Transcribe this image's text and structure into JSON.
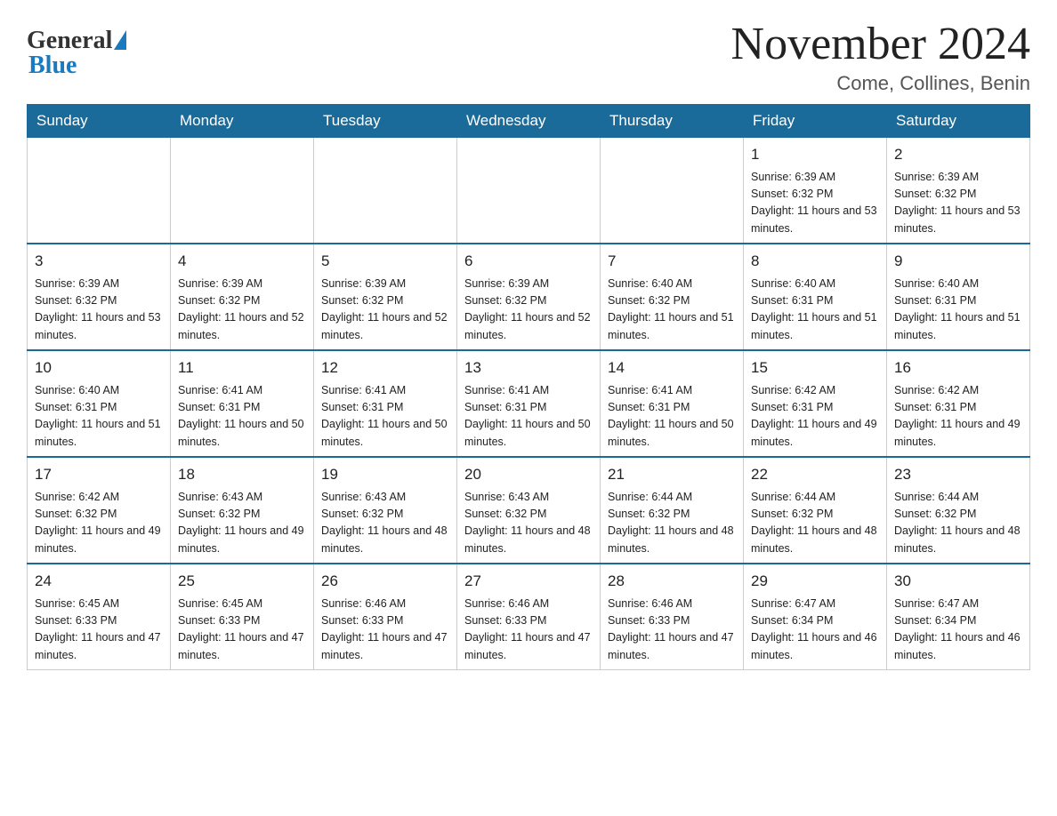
{
  "header": {
    "logo_general": "General",
    "logo_blue": "Blue",
    "month_title": "November 2024",
    "location": "Come, Collines, Benin"
  },
  "days_of_week": [
    "Sunday",
    "Monday",
    "Tuesday",
    "Wednesday",
    "Thursday",
    "Friday",
    "Saturday"
  ],
  "weeks": [
    [
      {
        "day": "",
        "info": ""
      },
      {
        "day": "",
        "info": ""
      },
      {
        "day": "",
        "info": ""
      },
      {
        "day": "",
        "info": ""
      },
      {
        "day": "",
        "info": ""
      },
      {
        "day": "1",
        "info": "Sunrise: 6:39 AM\nSunset: 6:32 PM\nDaylight: 11 hours and 53 minutes."
      },
      {
        "day": "2",
        "info": "Sunrise: 6:39 AM\nSunset: 6:32 PM\nDaylight: 11 hours and 53 minutes."
      }
    ],
    [
      {
        "day": "3",
        "info": "Sunrise: 6:39 AM\nSunset: 6:32 PM\nDaylight: 11 hours and 53 minutes."
      },
      {
        "day": "4",
        "info": "Sunrise: 6:39 AM\nSunset: 6:32 PM\nDaylight: 11 hours and 52 minutes."
      },
      {
        "day": "5",
        "info": "Sunrise: 6:39 AM\nSunset: 6:32 PM\nDaylight: 11 hours and 52 minutes."
      },
      {
        "day": "6",
        "info": "Sunrise: 6:39 AM\nSunset: 6:32 PM\nDaylight: 11 hours and 52 minutes."
      },
      {
        "day": "7",
        "info": "Sunrise: 6:40 AM\nSunset: 6:32 PM\nDaylight: 11 hours and 51 minutes."
      },
      {
        "day": "8",
        "info": "Sunrise: 6:40 AM\nSunset: 6:31 PM\nDaylight: 11 hours and 51 minutes."
      },
      {
        "day": "9",
        "info": "Sunrise: 6:40 AM\nSunset: 6:31 PM\nDaylight: 11 hours and 51 minutes."
      }
    ],
    [
      {
        "day": "10",
        "info": "Sunrise: 6:40 AM\nSunset: 6:31 PM\nDaylight: 11 hours and 51 minutes."
      },
      {
        "day": "11",
        "info": "Sunrise: 6:41 AM\nSunset: 6:31 PM\nDaylight: 11 hours and 50 minutes."
      },
      {
        "day": "12",
        "info": "Sunrise: 6:41 AM\nSunset: 6:31 PM\nDaylight: 11 hours and 50 minutes."
      },
      {
        "day": "13",
        "info": "Sunrise: 6:41 AM\nSunset: 6:31 PM\nDaylight: 11 hours and 50 minutes."
      },
      {
        "day": "14",
        "info": "Sunrise: 6:41 AM\nSunset: 6:31 PM\nDaylight: 11 hours and 50 minutes."
      },
      {
        "day": "15",
        "info": "Sunrise: 6:42 AM\nSunset: 6:31 PM\nDaylight: 11 hours and 49 minutes."
      },
      {
        "day": "16",
        "info": "Sunrise: 6:42 AM\nSunset: 6:31 PM\nDaylight: 11 hours and 49 minutes."
      }
    ],
    [
      {
        "day": "17",
        "info": "Sunrise: 6:42 AM\nSunset: 6:32 PM\nDaylight: 11 hours and 49 minutes."
      },
      {
        "day": "18",
        "info": "Sunrise: 6:43 AM\nSunset: 6:32 PM\nDaylight: 11 hours and 49 minutes."
      },
      {
        "day": "19",
        "info": "Sunrise: 6:43 AM\nSunset: 6:32 PM\nDaylight: 11 hours and 48 minutes."
      },
      {
        "day": "20",
        "info": "Sunrise: 6:43 AM\nSunset: 6:32 PM\nDaylight: 11 hours and 48 minutes."
      },
      {
        "day": "21",
        "info": "Sunrise: 6:44 AM\nSunset: 6:32 PM\nDaylight: 11 hours and 48 minutes."
      },
      {
        "day": "22",
        "info": "Sunrise: 6:44 AM\nSunset: 6:32 PM\nDaylight: 11 hours and 48 minutes."
      },
      {
        "day": "23",
        "info": "Sunrise: 6:44 AM\nSunset: 6:32 PM\nDaylight: 11 hours and 48 minutes."
      }
    ],
    [
      {
        "day": "24",
        "info": "Sunrise: 6:45 AM\nSunset: 6:33 PM\nDaylight: 11 hours and 47 minutes."
      },
      {
        "day": "25",
        "info": "Sunrise: 6:45 AM\nSunset: 6:33 PM\nDaylight: 11 hours and 47 minutes."
      },
      {
        "day": "26",
        "info": "Sunrise: 6:46 AM\nSunset: 6:33 PM\nDaylight: 11 hours and 47 minutes."
      },
      {
        "day": "27",
        "info": "Sunrise: 6:46 AM\nSunset: 6:33 PM\nDaylight: 11 hours and 47 minutes."
      },
      {
        "day": "28",
        "info": "Sunrise: 6:46 AM\nSunset: 6:33 PM\nDaylight: 11 hours and 47 minutes."
      },
      {
        "day": "29",
        "info": "Sunrise: 6:47 AM\nSunset: 6:34 PM\nDaylight: 11 hours and 46 minutes."
      },
      {
        "day": "30",
        "info": "Sunrise: 6:47 AM\nSunset: 6:34 PM\nDaylight: 11 hours and 46 minutes."
      }
    ]
  ]
}
